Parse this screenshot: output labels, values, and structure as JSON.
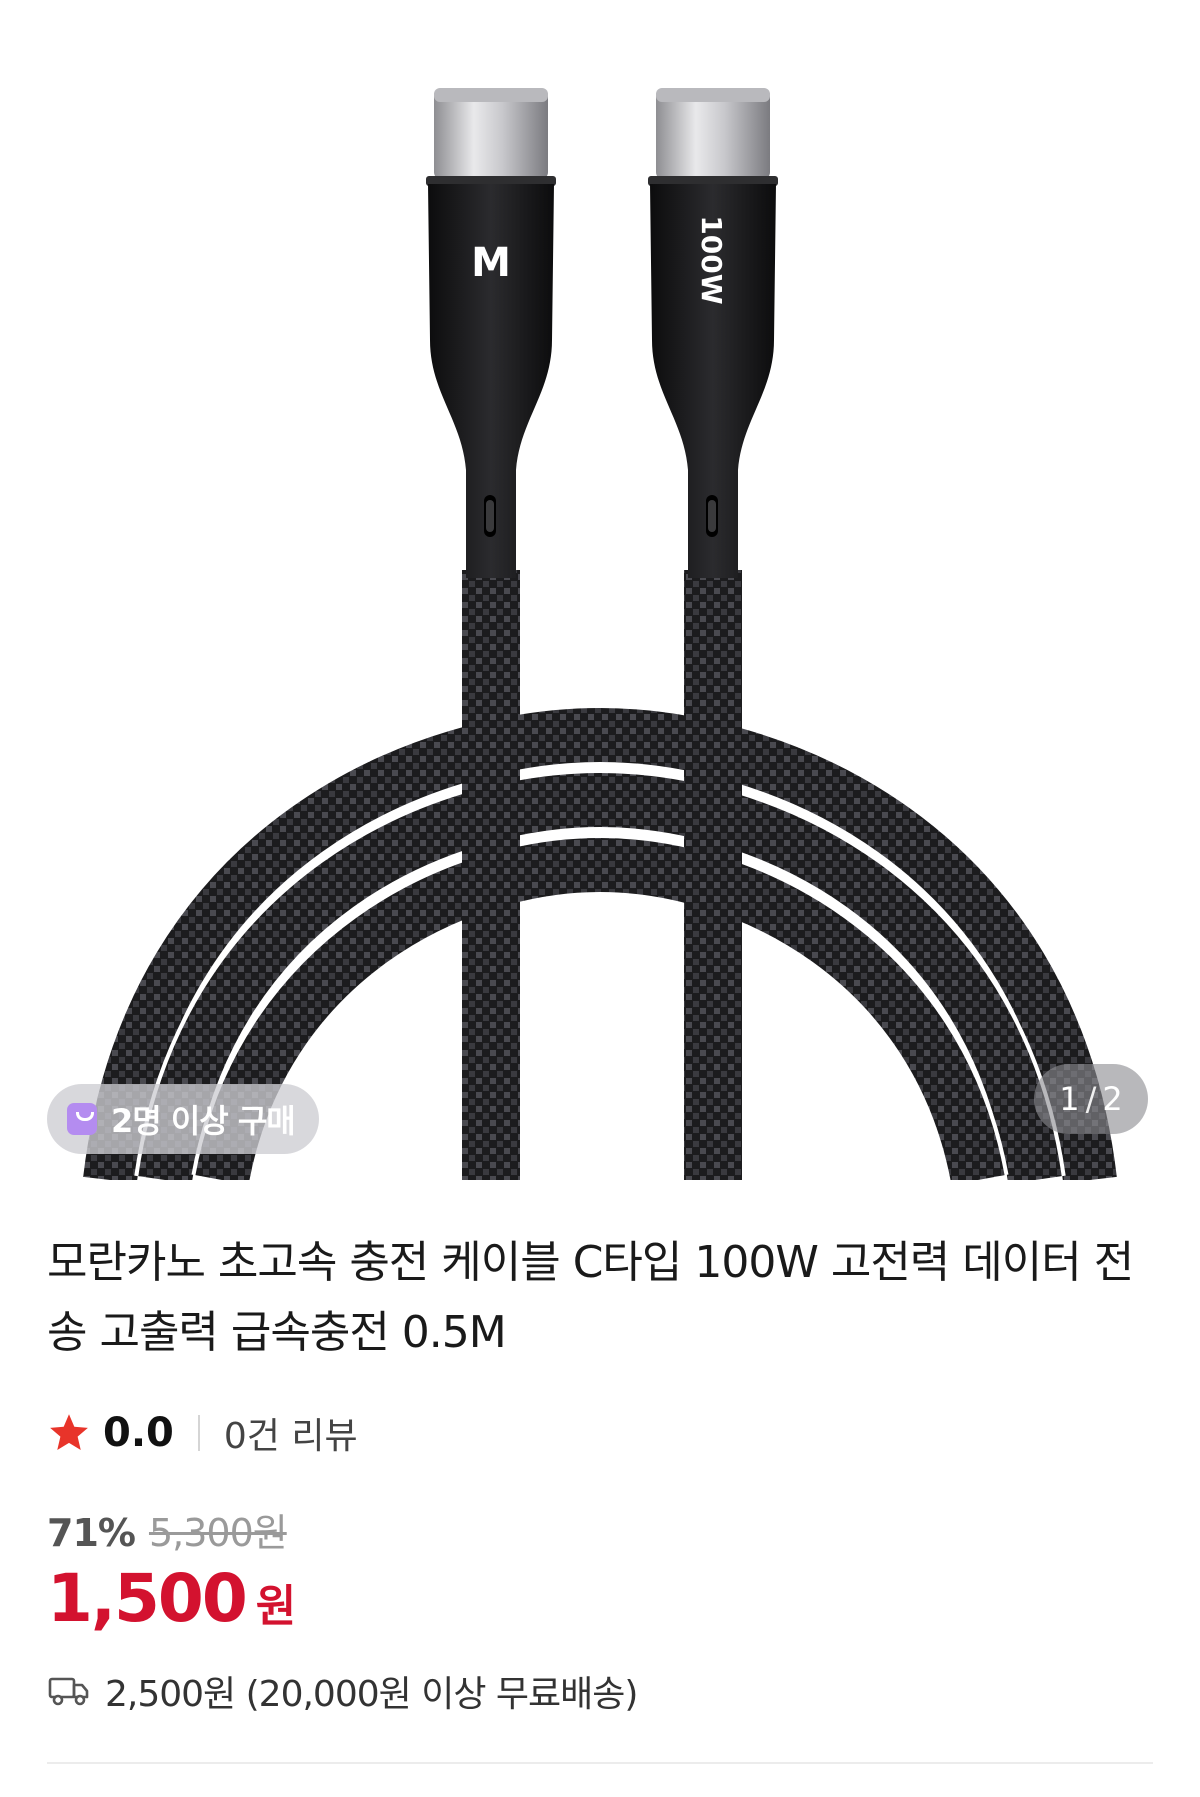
{
  "product_image": {
    "alt": "모란카노 USB-C 케이블",
    "connector_logo": "M",
    "connector_label": "100W",
    "buyer_badge": "2명 이상 구매",
    "pager": {
      "current": "1",
      "separator": "/",
      "total": "2"
    }
  },
  "product": {
    "title": "모란카노 초고속 충전 케이블 C타입 100W 고전력 데이터 전송 고출력 급속충전 0.5M",
    "rating": {
      "score": "0.0",
      "reviews": "0건 리뷰"
    },
    "price": {
      "discount": "71%",
      "original": "5,300원",
      "sale": "1,500",
      "currency": "원"
    },
    "shipping": "2,500원 (20,000원 이상 무료배송)"
  },
  "colors": {
    "accent_red": "#d3122f",
    "star": "#e8342a",
    "badge_icon": "#b48cf0"
  },
  "icons": {
    "rating": "star-icon",
    "shipping": "truck-icon",
    "badge": "shopping-bag-icon"
  }
}
